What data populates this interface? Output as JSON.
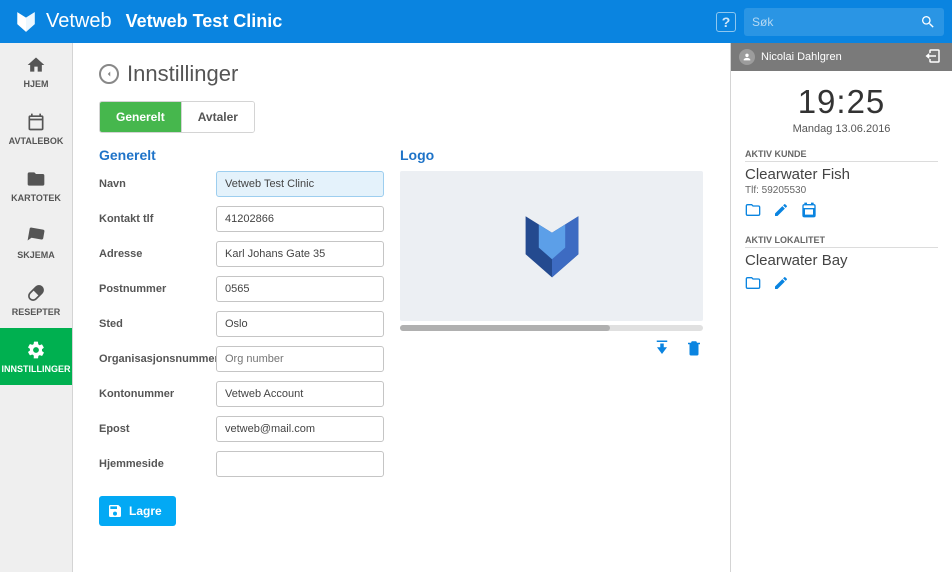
{
  "brand": {
    "name": "Vetweb"
  },
  "clinic_title": "Vetweb Test Clinic",
  "search": {
    "placeholder": "Søk"
  },
  "sidebar": {
    "items": [
      {
        "label": "HJEM"
      },
      {
        "label": "AVTALEBOK"
      },
      {
        "label": "KARTOTEK"
      },
      {
        "label": "SKJEMA"
      },
      {
        "label": "RESEPTER"
      },
      {
        "label": "INNSTILLINGER"
      }
    ]
  },
  "page": {
    "title": "Innstillinger"
  },
  "tabs": {
    "general": "Generelt",
    "appointments": "Avtaler"
  },
  "section": {
    "general": "Generelt",
    "logo": "Logo"
  },
  "form": {
    "labels": {
      "name": "Navn",
      "phone": "Kontakt tlf",
      "address": "Adresse",
      "postal": "Postnummer",
      "city": "Sted",
      "orgno_label": "Organisasjonsnummer",
      "account": "Kontonummer",
      "email": "Epost",
      "website": "Hjemmeside"
    },
    "values": {
      "name": "Vetweb Test Clinic",
      "phone": "41202866",
      "address": "Karl Johans Gate 35",
      "postal": "0565",
      "city": "Oslo",
      "orgno_placeholder": "Org number",
      "account": "Vetweb Account",
      "email": "vetweb@mail.com",
      "website": ""
    },
    "save": "Lagre"
  },
  "clock": {
    "time": "19:25",
    "date": "Mandag 13.06.2016"
  },
  "user": {
    "name": "Nicolai Dahlgren"
  },
  "customer": {
    "label": "AKTIV KUNDE",
    "name": "Clearwater Fish",
    "phone": "Tlf: 59205530"
  },
  "location": {
    "label": "AKTIV LOKALITET",
    "name": "Clearwater Bay"
  }
}
